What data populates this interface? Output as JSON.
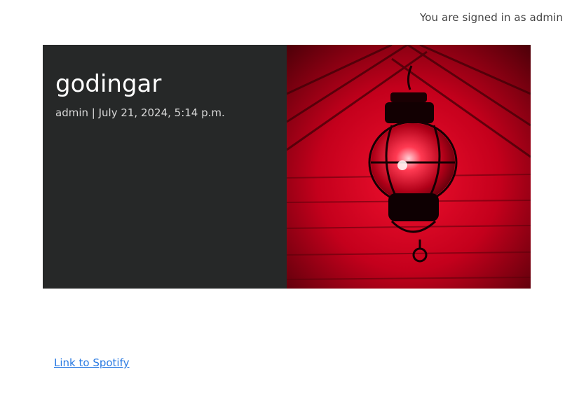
{
  "header": {
    "signed_in_text": "You are signed in as admin"
  },
  "post": {
    "title": "godingar",
    "meta": "admin | July 21, 2024, 5:14 p.m.",
    "image_description_icon": "red-lantern-image"
  },
  "links": {
    "spotify_label": "Link to Spotify"
  },
  "colors": {
    "panel_bg": "#262828",
    "link": "#2a7ae2",
    "image_red": "#d0001e"
  }
}
